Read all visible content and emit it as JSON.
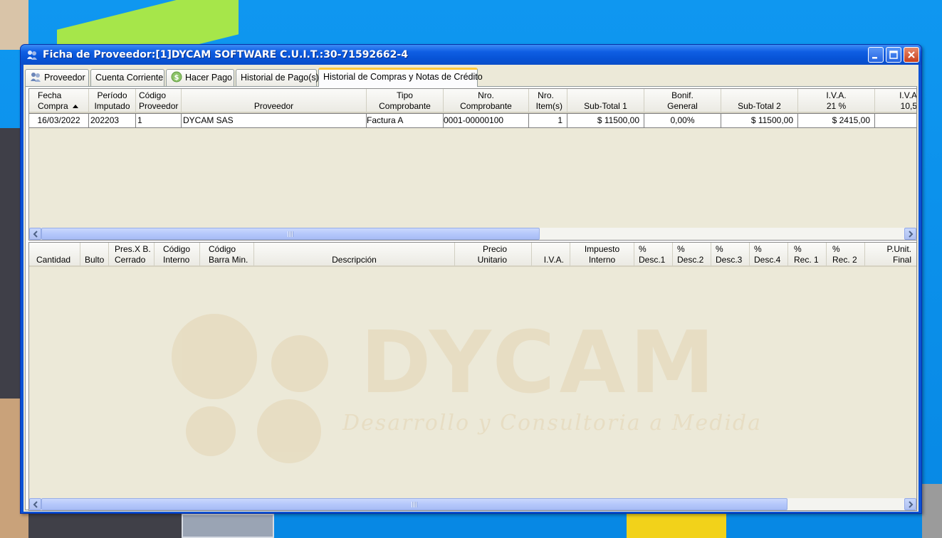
{
  "window": {
    "title": "Ficha de Proveedor:[1]DYCAM SOFTWARE C.U.I.T.:30-71592662-4"
  },
  "tabs": [
    {
      "label": "Proveedor",
      "icon": "user-group-icon"
    },
    {
      "label": "Cuenta Corriente"
    },
    {
      "label": "Hacer Pago",
      "icon": "money-icon"
    },
    {
      "label": "Historial de Pago(s)"
    },
    {
      "label": "Historial de Compras y Notas de Crédito",
      "active": true
    }
  ],
  "purchases_grid": {
    "columns": [
      {
        "line1": "Fecha",
        "line2": "Compra",
        "sorted": "ascending"
      },
      {
        "line1": "Período",
        "line2": "Imputado"
      },
      {
        "line1": "Código",
        "line2": "Proveedor"
      },
      {
        "line1": "",
        "line2": "Proveedor"
      },
      {
        "line1": "Tipo",
        "line2": "Comprobante"
      },
      {
        "line1": "Nro.",
        "line2": "Comprobante"
      },
      {
        "line1": "Nro.",
        "line2": "Item(s)"
      },
      {
        "line1": "",
        "line2": "Sub-Total 1"
      },
      {
        "line1": "Bonif.",
        "line2": "General"
      },
      {
        "line1": "",
        "line2": "Sub-Total 2"
      },
      {
        "line1": "I.V.A.",
        "line2": "21 %"
      },
      {
        "line1": "I.V.A",
        "line2": "10,5"
      }
    ],
    "rows": [
      {
        "fecha": "16/03/2022",
        "periodo": "202203",
        "codigo": "1",
        "proveedor": "DYCAM SAS",
        "tipo": "Factura A",
        "nro_comprobante": "0001-00000100",
        "items": "1",
        "subtotal1": "$ 11500,00",
        "bonif": "0,00%",
        "subtotal2": "$ 11500,00",
        "iva21": "$ 2415,00",
        "iva105": ""
      }
    ]
  },
  "items_grid": {
    "columns": [
      {
        "line1": "",
        "line2": "Cantidad"
      },
      {
        "line1": "",
        "line2": "Bulto"
      },
      {
        "line1": "Pres.X B.",
        "line2": "Cerrado"
      },
      {
        "line1": "Código",
        "line2": "Interno"
      },
      {
        "line1": "Código",
        "line2": "Barra Min."
      },
      {
        "line1": "",
        "line2": "Descripción"
      },
      {
        "line1": "Precio",
        "line2": "Unitario"
      },
      {
        "line1": "",
        "line2": "I.V.A."
      },
      {
        "line1": "Impuesto",
        "line2": "Interno"
      },
      {
        "line1": "%",
        "line2": "Desc.1"
      },
      {
        "line1": "%",
        "line2": "Desc.2"
      },
      {
        "line1": "%",
        "line2": "Desc.3"
      },
      {
        "line1": "%",
        "line2": "Desc.4"
      },
      {
        "line1": "%",
        "line2": "Rec. 1"
      },
      {
        "line1": "%",
        "line2": "Rec. 2"
      },
      {
        "line1": "P.Unit.",
        "line2": "Final"
      }
    ]
  },
  "watermark": {
    "brand": "DYCAM",
    "tagline": "Desarrollo y Consultoria a Medida"
  },
  "colors": {
    "titlebar": "#0a52d6",
    "panel": "#ece9d8",
    "active_tab_accent": "#ffc83c"
  }
}
